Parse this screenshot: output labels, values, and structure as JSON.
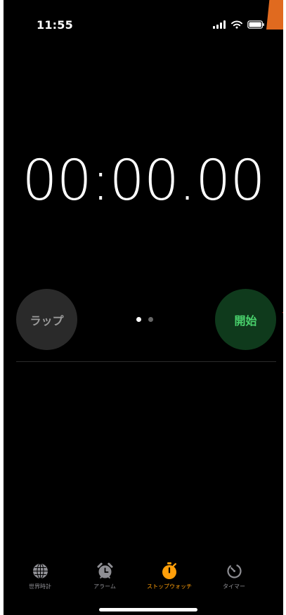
{
  "status_bar": {
    "time": "11:55",
    "icons": [
      "signal-icon",
      "wifi-icon",
      "battery-icon"
    ]
  },
  "stopwatch": {
    "display": "00:00.00",
    "lap_label": "ラップ",
    "start_label": "開始",
    "page_indicator": {
      "total": 2,
      "active_index": 0
    }
  },
  "tab_bar": {
    "items": [
      {
        "label": "世界時計",
        "icon": "globe-icon",
        "selected": false
      },
      {
        "label": "アラーム",
        "icon": "alarm-clock-icon",
        "selected": false
      },
      {
        "label": "ストップウォッチ",
        "icon": "stopwatch-icon",
        "selected": true
      },
      {
        "label": "タイマー",
        "icon": "timer-icon",
        "selected": false
      }
    ]
  },
  "colors": {
    "background": "#000000",
    "text": "#ffffff",
    "lap_button_background": "#2a2a2a",
    "lap_button_text": "#9b9b9b",
    "start_button_background": "#0f3a1c",
    "start_button_text": "#49d16c",
    "tab_inactive": "#8e8e93",
    "tab_active": "#ff9f0a"
  }
}
